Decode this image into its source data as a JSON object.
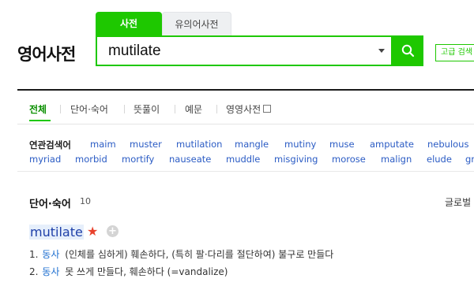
{
  "header": {
    "logo": "영어사전",
    "tabs": [
      "사전",
      "유의어사전"
    ],
    "search_value": "mutilate",
    "advanced_label": "고급 검색"
  },
  "subtabs": [
    "전체",
    "단어·숙어",
    "뜻풀이",
    "예문",
    "영영사전"
  ],
  "related": {
    "label": "연관검색어",
    "row1": [
      "maim",
      "muster",
      "mutilation",
      "mangle",
      "mutiny",
      "muse",
      "amputate",
      "nebulous"
    ],
    "row2": [
      "myriad",
      "morbid",
      "mortify",
      "nauseate",
      "muddle",
      "misgiving",
      "morose",
      "malign",
      "elude",
      "gr"
    ]
  },
  "section": {
    "title": "단어·숙어",
    "count": "10",
    "right_label": "글로벌"
  },
  "entry": {
    "word": "mutilate",
    "definitions": [
      {
        "num": "1.",
        "pos": "동사",
        "text": "(인체를 심하게) 훼손하다, (특히 팔·다리를 절단하여) 불구로 만들다"
      },
      {
        "num": "2.",
        "pos": "동사",
        "text": "못 쓰게 만들다, 훼손하다 (=vandalize)"
      }
    ]
  },
  "colors": {
    "accent": "#1ec800",
    "link": "#2a5bc4",
    "star": "#e8412c"
  }
}
